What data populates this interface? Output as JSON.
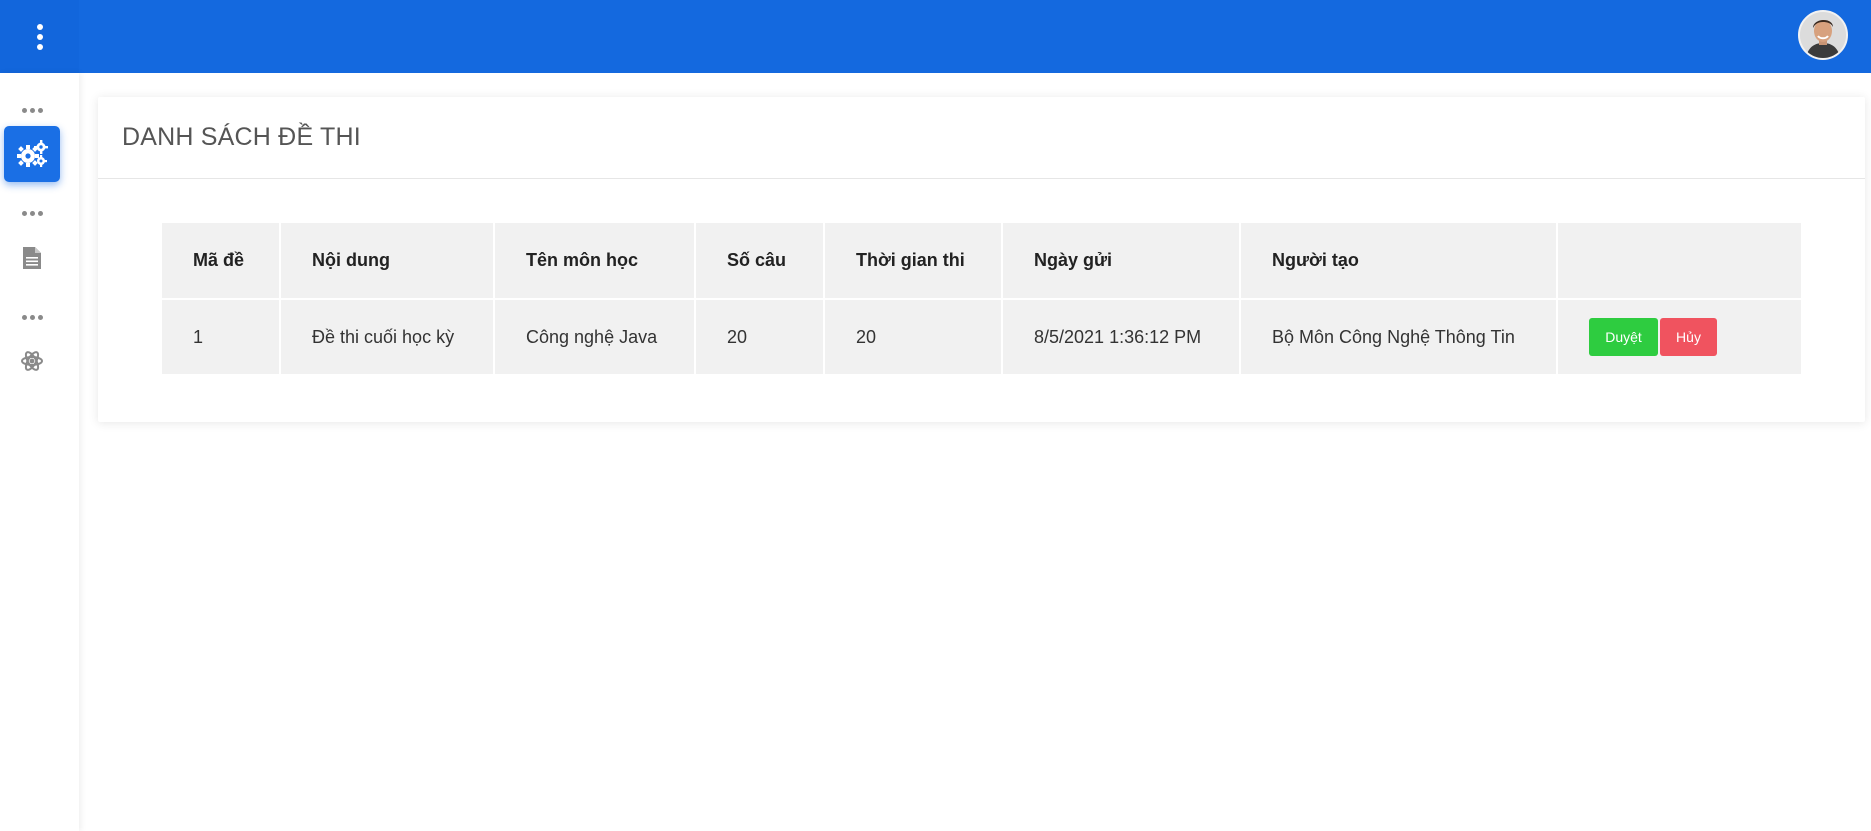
{
  "header": {
    "menu_icon": "kebab-menu-icon",
    "avatar_icon": "user-avatar"
  },
  "sidebar": {
    "items": [
      {
        "icon": "gears-icon",
        "active": true
      },
      {
        "icon": "document-icon",
        "active": false
      },
      {
        "icon": "atom-icon",
        "active": false
      }
    ]
  },
  "main": {
    "title": "DANH SÁCH ĐỀ THI",
    "table": {
      "columns": [
        "Mã đề",
        "Nội dung",
        "Tên môn học",
        "Số câu",
        "Thời gian thi",
        "Ngày gửi",
        "Người tạo",
        ""
      ],
      "rows": [
        {
          "ma_de": "1",
          "noi_dung": "Đề thi cuối học kỳ",
          "ten_mon_hoc": "Công nghệ Java",
          "so_cau": "20",
          "thoi_gian_thi": "20",
          "ngay_gui": "8/5/2021 1:36:12 PM",
          "nguoi_tao": "Bộ Môn Công Nghệ Thông Tin",
          "approve_label": "Duyệt",
          "cancel_label": "Hủy"
        }
      ]
    }
  },
  "colors": {
    "topbar": "#1469df",
    "approve": "#2ecc40",
    "cancel": "#f0535f"
  }
}
